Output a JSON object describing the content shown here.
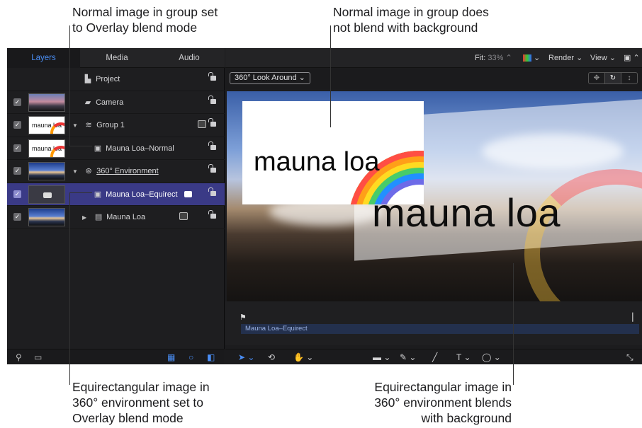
{
  "callouts": {
    "top_left": [
      "Normal image in group set",
      "to Overlay blend mode"
    ],
    "top_right": [
      "Normal image in group does",
      "not blend with background"
    ],
    "bottom_left": [
      "Equirectangular image in",
      "360° environment set to",
      "Overlay blend mode"
    ],
    "bottom_right": [
      "Equirectangular image in",
      "360° environment blends",
      "with background"
    ]
  },
  "tabs": [
    "Layers",
    "Media",
    "Audio"
  ],
  "layers": [
    {
      "label": "Project",
      "icon": "project-icon",
      "checked": false
    },
    {
      "label": "Camera",
      "icon": "camera-icon",
      "checked": true,
      "thumb": "sky"
    },
    {
      "label": "Group 1",
      "icon": "group-icon",
      "checked": true,
      "thumb": "white",
      "thumb_text": "mauna loa"
    },
    {
      "label": "Mauna Loa–Normal",
      "icon": "image-icon",
      "checked": true,
      "thumb": "white",
      "thumb_text": "mauna loa"
    },
    {
      "label": "360° Environment",
      "icon": "environment-icon",
      "checked": true,
      "thumb": "pano"
    },
    {
      "label": "Mauna Loa–Equirect",
      "icon": "image-icon",
      "checked": true,
      "thumb": "gray",
      "selected": true
    },
    {
      "label": "Mauna Loa",
      "icon": "film-icon",
      "checked": true,
      "thumb": "pano"
    }
  ],
  "toolbar": {
    "fit_label": "Fit:",
    "fit_value": "33%",
    "render_label": "Render",
    "view_label": "View"
  },
  "canvas": {
    "look_around": "360° Look Around",
    "card_text": "mauna loa",
    "big_text": "mauna loa"
  },
  "timeline": {
    "clip_label": "Mauna Loa–Equirect"
  }
}
